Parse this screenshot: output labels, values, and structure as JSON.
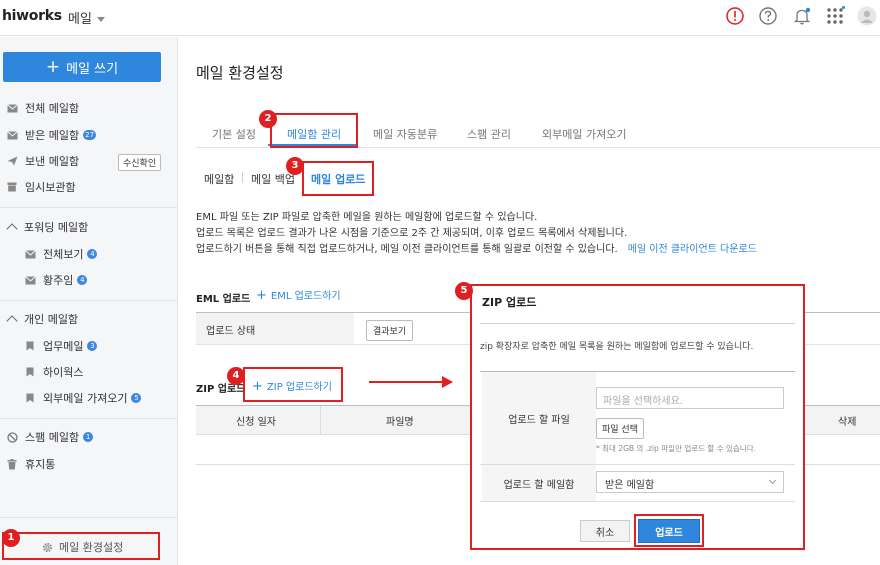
{
  "header": {
    "logo": "hiworks",
    "app_name": "메일"
  },
  "sidebar": {
    "compose_label": "메일 쓰기",
    "items": [
      {
        "label": "전체 메일함"
      },
      {
        "label": "받은 메일함",
        "badge": "27"
      },
      {
        "label": "보낸 메일함",
        "chip": "수신확인"
      },
      {
        "label": "임시보관함"
      }
    ],
    "groups": [
      {
        "label": "포워딩 메일함",
        "items": [
          {
            "label": "전체보기",
            "badge": "4"
          },
          {
            "label": "황주임",
            "badge": "4"
          }
        ]
      },
      {
        "label": "개인 메일함",
        "items": [
          {
            "label": "업무메일",
            "badge": "3"
          },
          {
            "label": "하이웍스"
          },
          {
            "label": "외부메일 가져오기",
            "badge": "5"
          }
        ]
      }
    ],
    "bottom_items": [
      {
        "label": "스팸 메일함",
        "badge": "1"
      },
      {
        "label": "휴지통"
      }
    ],
    "settings_label": "메일 환경설정"
  },
  "main": {
    "title": "메일 환경설정",
    "tabs": [
      "기본 설정",
      "메일함 관리",
      "메일 자동분류",
      "스팸 관리",
      "외부메일 가져오기"
    ],
    "subtabs": [
      "메일함",
      "메일 백업",
      "메일 업로드"
    ],
    "desc": [
      "EML 파일 또는 ZIP 파일로 압축한 메일을 원하는 메일함에 업로드할 수 있습니다.",
      "업로드 목록은 업로드 결과가 나온 시점을 기준으로 2주 간 제공되며, 이후 업로드 목록에서 삭제됩니다.",
      "업로드하기 버튼을 통해 직접 업로드하거나, 메일 이전 클라이언트를 통해 일괄로 이전할 수 있습니다."
    ],
    "desc_link": "메일 이전 클라이언트 다운로드",
    "eml": {
      "title": "EML 업로드",
      "link": "EML 업로드하기",
      "status_label": "업로드 상태",
      "result_button": "결과보기"
    },
    "zip": {
      "title": "ZIP 업로드",
      "link": "ZIP 업로드하기",
      "columns": [
        "신청 일자",
        "파일명",
        "삭제"
      ]
    }
  },
  "modal": {
    "title": "ZIP 업로드",
    "desc": "zip 확장자로 압축한 메일 목록을 원하는 메일함에 업로드할 수 있습니다.",
    "file_label": "업로드 할 파일",
    "file_placeholder": "파일을 선택하세요.",
    "file_button": "파일 선택",
    "hint": "* 최대 2GB 의 .zip 파일만 업로드 할 수 있습니다.",
    "mailbox_label": "업로드 할 메일함",
    "mailbox_value": "받은 메일함",
    "cancel": "취소",
    "upload": "업로드"
  },
  "annotations": [
    "1",
    "2",
    "3",
    "4",
    "5"
  ],
  "colors": {
    "accent": "#2f86dd",
    "annotation": "#e02020"
  }
}
